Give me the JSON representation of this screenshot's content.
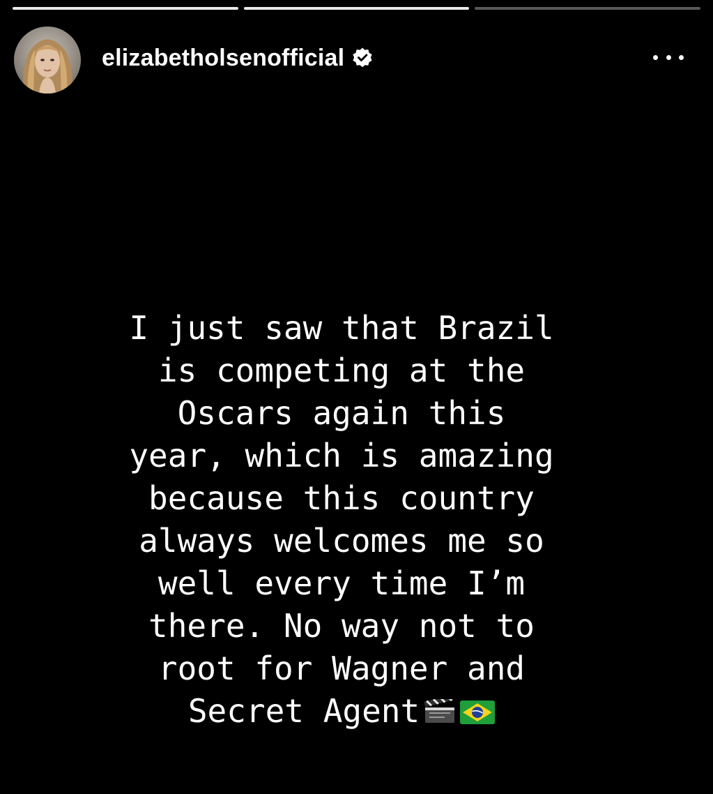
{
  "story": {
    "progress": [
      {
        "fill_percent": 100
      },
      {
        "fill_percent": 100
      },
      {
        "fill_percent": 0
      }
    ]
  },
  "header": {
    "username": "elizabetholsenofficial",
    "verified": true,
    "more_icon": "more-horizontal-icon"
  },
  "message": {
    "text": "I just saw that Brazil\nis competing at the\nOscars again this\nyear, which is amazing\nbecause this country\nalways welcomes me so\nwell every time I’m\nthere. No way not to\nroot for Wagner and\nSecret Agent",
    "emojis": [
      "clapper-board-icon",
      "brazil-flag-icon"
    ]
  }
}
